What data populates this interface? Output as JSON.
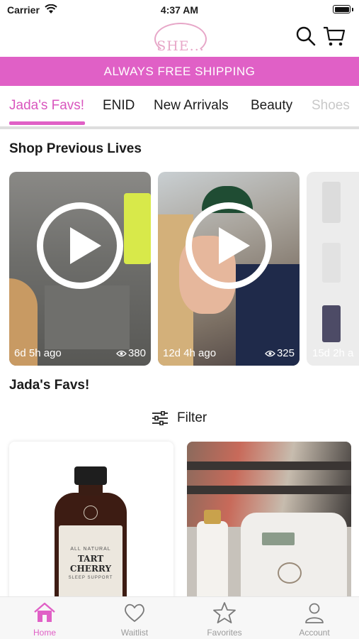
{
  "status_bar": {
    "carrier": "Carrier",
    "time": "4:37 AM"
  },
  "header": {
    "logo_text": "SHE...",
    "icons": [
      "search-icon",
      "cart-icon"
    ]
  },
  "banner": {
    "text": "ALWAYS FREE SHIPPING",
    "color": "#e060c6"
  },
  "tabs": [
    {
      "label": "Jada's Favs!",
      "active": true
    },
    {
      "label": "ENID",
      "active": false
    },
    {
      "label": "New Arrivals",
      "active": false
    },
    {
      "label": "Beauty",
      "active": false
    },
    {
      "label": "Shoes",
      "active": false
    }
  ],
  "previous_lives": {
    "title": "Shop Previous Lives",
    "items": [
      {
        "age": "6d 5h ago",
        "views": "380"
      },
      {
        "age": "12d 4h ago",
        "views": "325"
      },
      {
        "age": "15d 2h a",
        "views": ""
      }
    ]
  },
  "favs_section": {
    "title": "Jada's Favs!",
    "filter_label": "Filter"
  },
  "products": [
    {
      "label_line1": "TART CHERRY",
      "label_small1": "ALL NATURAL",
      "label_small2": "SLEEP SUPPORT"
    },
    {
      "label_line1": ""
    }
  ],
  "tab_bar": {
    "accent_color": "#e060c6",
    "items": [
      {
        "label": "Home",
        "icon": "home-icon",
        "active": true
      },
      {
        "label": "Waitlist",
        "icon": "heart-icon",
        "active": false
      },
      {
        "label": "Favorites",
        "icon": "star-icon",
        "active": false
      },
      {
        "label": "Account",
        "icon": "person-icon",
        "active": false
      }
    ]
  }
}
